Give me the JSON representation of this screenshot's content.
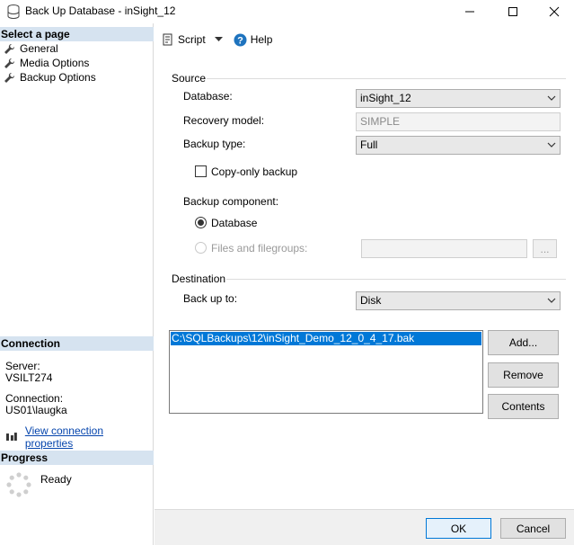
{
  "window": {
    "title": "Back Up Database - inSight_12"
  },
  "left": {
    "select_page_header": "Select a page",
    "pages": [
      {
        "label": "General"
      },
      {
        "label": "Media Options"
      },
      {
        "label": "Backup Options"
      }
    ],
    "connection_header": "Connection",
    "server_label": "Server:",
    "server_value": "VSILT274",
    "connection_label": "Connection:",
    "connection_value": "US01\\laugka",
    "view_props_link": "View connection properties",
    "progress_header": "Progress",
    "progress_status": "Ready"
  },
  "toolbar": {
    "script_label": "Script",
    "help_label": "Help"
  },
  "source": {
    "section_label": "Source",
    "database_label": "Database:",
    "database_value": "inSight_12",
    "recovery_label": "Recovery model:",
    "recovery_value": "SIMPLE",
    "backup_type_label": "Backup type:",
    "backup_type_value": "Full",
    "copy_only_label": "Copy-only backup",
    "copy_only_checked": false,
    "component_label": "Backup component:",
    "component_database_label": "Database",
    "component_files_label": "Files and filegroups:",
    "files_browse_label": "..."
  },
  "destination": {
    "section_label": "Destination",
    "back_up_to_label": "Back up to:",
    "back_up_to_value": "Disk",
    "paths": [
      "C:\\SQLBackups\\12\\inSight_Demo_12_0_4_17.bak"
    ],
    "add_label": "Add...",
    "remove_label": "Remove",
    "contents_label": "Contents"
  },
  "footer": {
    "ok_label": "OK",
    "cancel_label": "Cancel"
  },
  "colors": {
    "section_header_bg": "#d6e3f0",
    "selection_blue": "#0078d7",
    "link": "#0645ad",
    "help_icon": "#1e73be"
  }
}
